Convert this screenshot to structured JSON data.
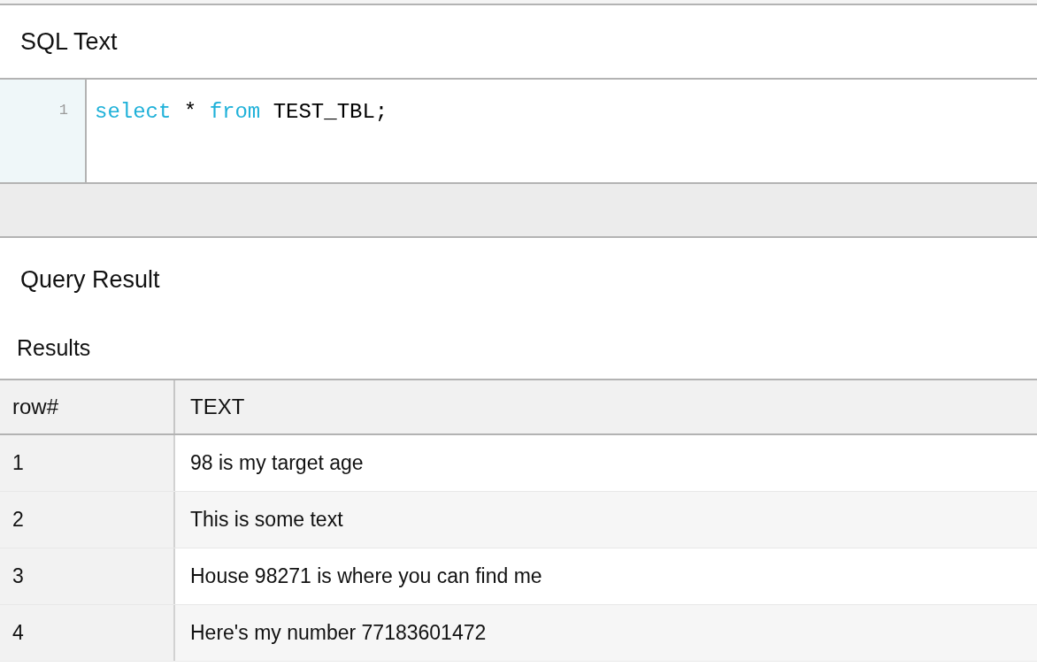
{
  "sql_text": {
    "title": "SQL Text",
    "editor": {
      "lines": [
        {
          "number": "1",
          "tokens": [
            {
              "text": "select",
              "kind": "keyword"
            },
            {
              "text": " * ",
              "kind": "plain"
            },
            {
              "text": "from",
              "kind": "keyword"
            },
            {
              "text": " TEST_TBL;",
              "kind": "plain"
            }
          ]
        }
      ]
    }
  },
  "query_result": {
    "title": "Query Result",
    "results_label": "Results",
    "table": {
      "columns": [
        "row#",
        "TEXT"
      ],
      "rows": [
        [
          "1",
          "98 is my target age"
        ],
        [
          "2",
          "This is some text"
        ],
        [
          "3",
          "House 98271 is where you can find me"
        ],
        [
          "4",
          "Here's my number 77183601472"
        ]
      ]
    }
  }
}
